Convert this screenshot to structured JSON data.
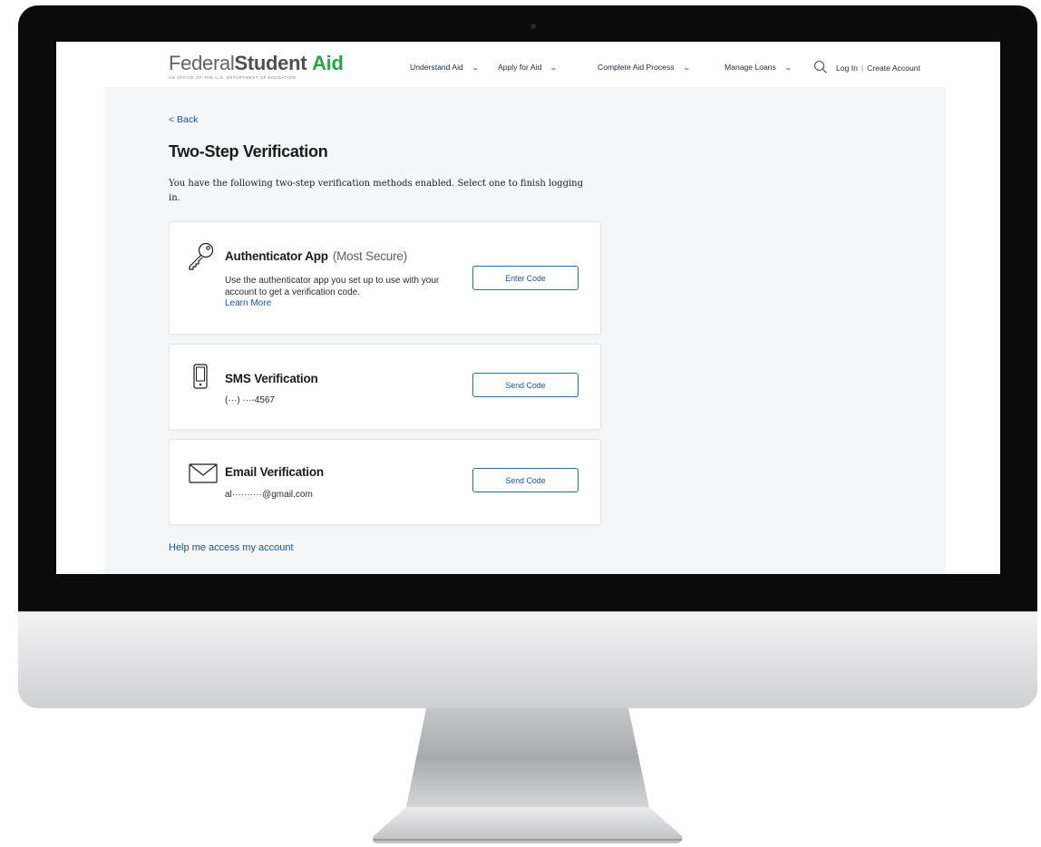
{
  "header": {
    "logo": {
      "word_federal": "Federal",
      "word_student": "Student",
      "word_aid": "Aid",
      "tagline": "An Office of the U.S. Department of Education"
    },
    "nav": [
      {
        "label": "Understand Aid",
        "icon": "chevron-down-icon"
      },
      {
        "label": "Apply for Aid",
        "icon": "chevron-down-icon"
      },
      {
        "label": "Complete Aid Process",
        "icon": "chevron-down-icon"
      },
      {
        "label": "Manage Loans",
        "icon": "chevron-down-icon"
      }
    ],
    "search_icon": "search-icon",
    "login": "Log In",
    "separator": "|",
    "create_account": "Create Account"
  },
  "page": {
    "back": "< Back",
    "title": "Two-Step Verification",
    "intro": "You have the following two-step verification methods enabled. Select one to finish logging in."
  },
  "methods": [
    {
      "title": "Authenticator App",
      "qualifier": "(Most Secure)",
      "description": "Use the authenticator app you set up to use with your account to get a verification code.",
      "link": "Learn More",
      "button": "Enter Code",
      "icon": "key-icon"
    },
    {
      "title": "SMS Verification",
      "detail": "(···) ···-4567",
      "button": "Send Code",
      "icon": "phone-icon"
    },
    {
      "title": "Email Verification",
      "detail": "al··········@gmail.com",
      "button": "Send Code",
      "icon": "envelope-icon"
    }
  ],
  "help_link": "Help me access my account",
  "colors": {
    "brand_green": "#2aa24a",
    "link_blue": "#205493",
    "button_border": "#2e6da4",
    "content_bg": "#f5f6f7"
  }
}
